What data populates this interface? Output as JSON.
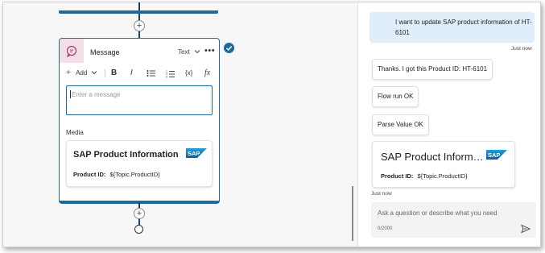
{
  "canvas": {
    "node": {
      "title": "Message",
      "type_label": "Text",
      "more_label": "•••",
      "toolbar": {
        "add_label": "Add",
        "bold": "B",
        "italic": "I",
        "variable": "{x}",
        "formula": "fx"
      },
      "message_placeholder": "Enter a message",
      "media_label": "Media",
      "card": {
        "title": "SAP Product Information",
        "product_label": "Product ID:",
        "product_value": "${Topic.ProductID}"
      }
    },
    "add_step_symbol": "+"
  },
  "chat": {
    "user_message": "I want to update SAP product information of HT-6101",
    "user_time": "Just now",
    "bot_messages": [
      "Thanks. I got this Product ID: HT-6101",
      "Flow run OK",
      "Parse Value OK"
    ],
    "card": {
      "title": "SAP Product Inform…",
      "product_label": "Product ID:",
      "product_value": "${Topic.ProductID}"
    },
    "bot_time": "Just now",
    "input_placeholder": "Ask a question or describe what you need",
    "counter": "0/2000"
  },
  "logo_text": "SAP",
  "colors": {
    "accent": "#1d6a9e",
    "connector": "#1d3f5e",
    "user_bubble": "#dfeef9",
    "node_icon_bg": "#f2dfe8"
  }
}
